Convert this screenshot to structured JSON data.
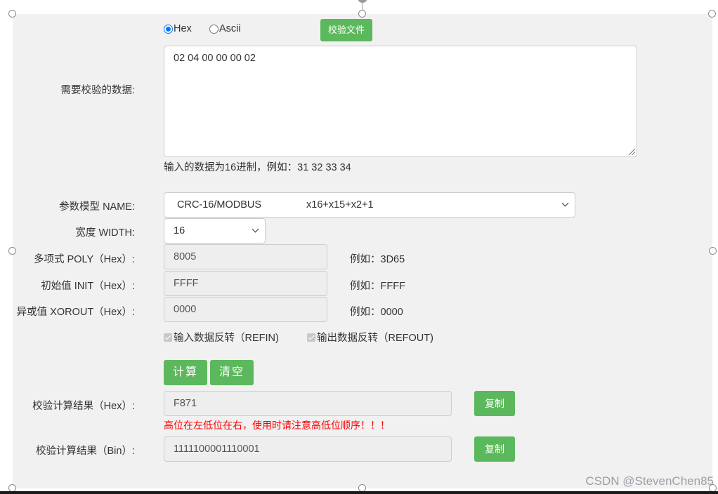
{
  "format": {
    "hex_label": "Hex",
    "ascii_label": "Ascii",
    "selected": "Hex",
    "verify_file_button": "校验文件"
  },
  "data_input": {
    "label": "需要校验的数据:",
    "value": "02 04 00 00 00 02",
    "hint": "输入的数据为16进制，例如：31 32 33 34"
  },
  "params": {
    "model_label": "参数模型 NAME:",
    "model_name": "CRC-16/MODBUS",
    "model_poly_text": "x16+x15+x2+1",
    "width_label": "宽度 WIDTH:",
    "width_value": "16",
    "poly_label": "多项式 POLY（Hex）:",
    "poly_value": "8005",
    "poly_example": "例如：3D65",
    "init_label": "初始值 INIT（Hex）:",
    "init_value": "FFFF",
    "init_example": "例如：FFFF",
    "xorout_label": "异或值 XOROUT（Hex）:",
    "xorout_value": "0000",
    "xorout_example": "例如：0000",
    "refin_label": "输入数据反转（REFIN)",
    "refout_label": "输出数据反转（REFOUT)"
  },
  "actions": {
    "calculate": "计算",
    "clear": "清空"
  },
  "results": {
    "hex_label": "校验计算结果（Hex）:",
    "hex_value": "F871",
    "copy_label": "复制",
    "warning": "高位在左低位在右，使用时请注意高低位顺序！！！",
    "bin_label": "校验计算结果（Bin）:",
    "bin_value": "1111100001110001"
  },
  "watermark": "CSDN @StevenChen85",
  "colors": {
    "accent_green": "#5cb85c",
    "warning_red": "#ff0000",
    "panel_bg": "#f1f1f1"
  }
}
